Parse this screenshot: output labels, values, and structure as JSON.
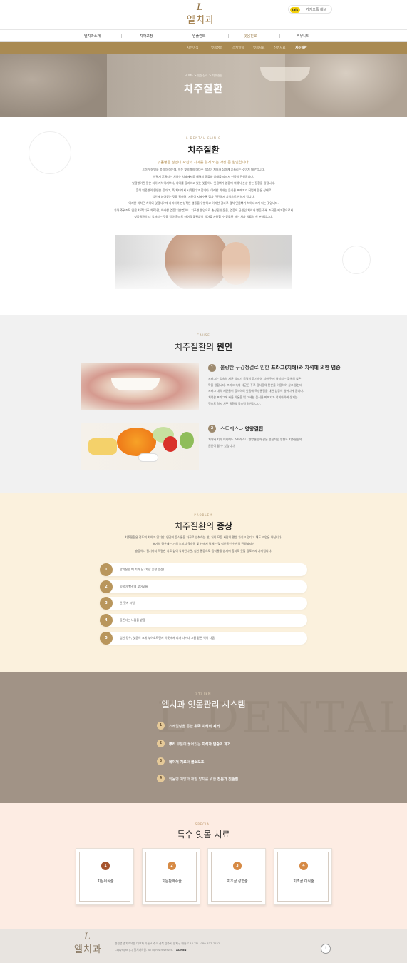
{
  "header": {
    "logo_mark": "L",
    "logo_text": "엘치과",
    "kakao_icon": "talk",
    "kakao_label": "카카오톡 채널"
  },
  "gnb": {
    "items": [
      "엘치과소개",
      "치아교정",
      "임플란트",
      "잇몸진료",
      "커뮤니티"
    ],
    "active_index": 3
  },
  "subnav": {
    "items": [
      "치은이식",
      "잇몸성형",
      "스케일링",
      "잇몸치료",
      "신경치료",
      "치주질환"
    ],
    "active_index": 5
  },
  "hero": {
    "breadcrumb": "HOME > 잇몸진료 > 치주질환",
    "title": "치주질환"
  },
  "intro": {
    "eng": "L DENTAL CLINIC",
    "title": "치주질환",
    "lead": "잇몸병은 성인이 자신의 치아를 잃게 되는 가장 큰 원인입니다.",
    "lines": [
      "흔히 잇몸병을 풍치라 하는데, 이는 잇몸병의 대다수 증상이 치아가 심하게 흔들리는 것이기 때문입니다.",
      "이렇게 흔들리는 치아는 치과에서도 해결의 종류와 상태를 따져서 신중히 진행됩니다.",
      "잇몸병이란 말은 치아 자체이기보다, 치아를 둘러싸고 있는 잇몸이나 잇몸뼈가 염증에 의해서 손상 받는 질환을 말합니다.",
      "흔히 잇몸병의 원인은 플라그, 즉 치태에서 시작된다고 합니다. 이러한 치태는 음식물 찌꺼기가 뒤덮여 많은 상태로",
      "입안에 남아있는 것을 말하며, 시간이 지날수록 점차 단단해져 치석으로 변하게 됩니다.",
      "이러한 치석은 치아와 잇몸사이에 자리하여 만성적인 염증을 유발하고 이러한 결과로 점차 잇몸뼈가 녹아내리게 되는 것입니다.",
      "치아 주위조직 잇몸 치료(치주 치료)란, 이러한 염증(치은염)이나 치주병 원인으로 손상된 잇몸을, 염증의 근원인 치석과 병든 주위 조직을 제거함으로서",
      "잇몸질환이 더 악화되는 것을 막아 환자로 하여금 불편없이 치아를 사용할 수 있도록 하는 치과 치료의 한 분야입니다."
    ]
  },
  "cause": {
    "eng": "CAUSE",
    "title_a": "치주질환의 ",
    "title_b": "원인",
    "items": [
      {
        "num": "1",
        "title_a": "불량한 구강청결로 인한 ",
        "title_b": "프라그(치태)와 치석에 의한 염증",
        "lines": [
          "프라그는 입속의 세균 성지가 공격이 증가하여 치아 면에 형성되는 무색의 얇은",
          "막을 말합니다. 프라그 속의 세균은 주로 음식물의 탄분을 이용하여 살고 있는데",
          "프라그 내의 세균들이 증식하여 잇몸에 독성물질을 내면 염증이 일어나게 됩니다.",
          "치석은 프라그에 카룸 이온을 및 미세한 음식물 찌꺼기가 석회화하여 생기는",
          "것으로 역시 치주 질환의 극소적 원인입니다."
        ]
      },
      {
        "num": "2",
        "title_a": "스트레스나 ",
        "title_b": "영양결핍",
        "lines": [
          "치아와 치아 이외에도 스트레스나 영양결핍과 같은 전신적인 영향도 치주질환의",
          "원인이 될 수 있습니다."
        ]
      }
    ]
  },
  "problem": {
    "eng": "PROBLEM",
    "title_a": "치주질환의 ",
    "title_b": "증상",
    "lines": [
      "치주질환은 정도의 차이가 있지만, 인간이 음식물을 자꾸로 섭취하는 한, 거의 모든 사람이 평생 가지고 있다고 해도 과언은 아닙니다.",
      "초기의 경우에는 거의 느끼지 못하며 몇 년에서 길게는 몇 십년동안 천천히 진행되지만",
      "충증이나 말기까지 적절한 치료 없이 악화된다면, 심한 통증으로 음식물을 씹기에 힘지도 못할 정도까지 가게됩니다."
    ],
    "items": [
      {
        "num": "1",
        "text": "양치질할 때 피가 남 (가장 흔한 증상)"
      },
      {
        "num": "2",
        "text": "잇몸이 빨갛게 부어오름"
      },
      {
        "num": "3",
        "text": "찬 것에 시림"
      },
      {
        "num": "4",
        "text": "들뜬다는 느낌을 받음"
      },
      {
        "num": "5",
        "text": "심한 경우, 잇몸이 크게 부어오르면서 이곳에서 피가 나거나 고름 같은 액이 나옴"
      }
    ]
  },
  "system": {
    "eng": "SYSTEM",
    "title": "엘치과 잇몸관리 시스템",
    "bg_text": "L DENTALCLINIC",
    "items": [
      {
        "num": "1",
        "pre": "스케일링을 통한 ",
        "bold": "위쪽 치석의 제거",
        "post": ""
      },
      {
        "num": "2",
        "pre": "",
        "bold": "뿌리",
        "post": " 부분에 붙어있는 ",
        "bold2": "치석과 염증의 제거"
      },
      {
        "num": "3",
        "pre": "",
        "bold": "레이저 치료",
        "post": "와 ",
        "bold2": "불소도포"
      },
      {
        "num": "4",
        "pre": "잇몸병 예방과 재발 방지를 위한 ",
        "bold": "전문가 칫솔질",
        "post": ""
      }
    ]
  },
  "special": {
    "eng": "SPECIAL",
    "title": "특수 잇몸 치료",
    "items": [
      {
        "num": "1",
        "label": "치은이식술"
      },
      {
        "num": "2",
        "label": "치은판막수술"
      },
      {
        "num": "3",
        "label": "치조골 성형술"
      },
      {
        "num": "4",
        "label": "치조골 이식술"
      }
    ]
  },
  "footer": {
    "logo_mark": "L",
    "logo_text": "엘치과",
    "line1": "병원명 엘치과의원   대표자 이름요   주소 경북 경주시 황지구 태릉로 48   TEL. 080-337-7522",
    "line2": "Copyright (C) 엘치과의원. All rights reserved.",
    "admin": "ADMIN",
    "top": "↑"
  },
  "colors": {
    "gold": "#a98a52",
    "accent": "#b08a4c",
    "cause_num": "#9d8a6f",
    "symptom_num": "#b9965c",
    "special_num": "#d68a45"
  }
}
